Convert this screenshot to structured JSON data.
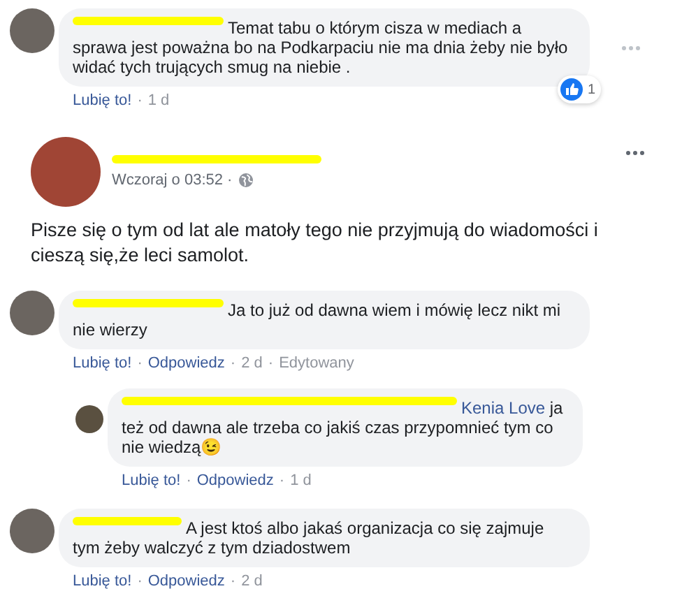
{
  "first_comment": {
    "text": "Temat tabu o którym cisza w mediach a sprawa jest poważna bo na Podkarpaciu nie ma dnia żeby nie było widać tych trujących smug na niebie .",
    "reaction_count": "1",
    "actions": [
      {
        "label": "Lubię to!",
        "kind": "link"
      },
      {
        "label": "1 d",
        "kind": "time"
      }
    ]
  },
  "separator": "·",
  "post": {
    "time": "Wczoraj o 03:52 ·",
    "text": "Pisze się o tym od lat ale matoły tego nie przyjmują do wiadomości i cieszą się,że leci samolot."
  },
  "comments": [
    {
      "text": "Ja to już od dawna wiem i mówię lecz nikt mi nie wierzy",
      "actions": [
        {
          "label": "Lubię to!",
          "kind": "link"
        },
        {
          "label": "Odpowiedz",
          "kind": "link"
        },
        {
          "label": "2 d",
          "kind": "time"
        },
        {
          "label": "Edytowany",
          "kind": "time"
        }
      ],
      "children": [
        {
          "mention": "Kenia Love",
          "text": "ja też od dawna ale trzeba co jakiś czas przypomnieć tym co nie wiedzą",
          "emoji": "😉",
          "actions": [
            {
              "label": "Lubię to!",
              "kind": "link"
            },
            {
              "label": "Odpowiedz",
              "kind": "link"
            },
            {
              "label": "1 d",
              "kind": "time"
            }
          ]
        }
      ]
    },
    {
      "text": "A jest ktoś albo jakaś organizacja co się zajmuje tym żeby walczyć z tym dziadostwem",
      "actions": [
        {
          "label": "Lubię to!",
          "kind": "link"
        },
        {
          "label": "Odpowiedz",
          "kind": "link"
        },
        {
          "label": "2 d",
          "kind": "time"
        }
      ]
    }
  ]
}
